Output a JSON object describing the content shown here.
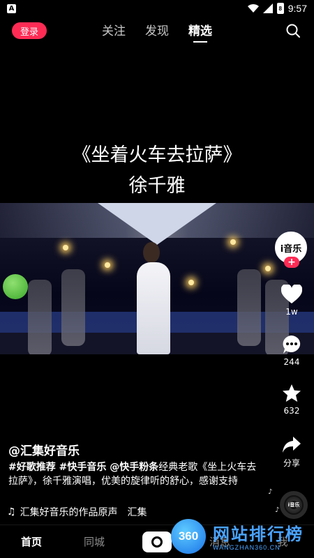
{
  "status_bar": {
    "time": "9:57",
    "notification_icon": "A"
  },
  "top_nav": {
    "login_label": "登录",
    "tabs": [
      {
        "label": "关注",
        "active": false
      },
      {
        "label": "发现",
        "active": false
      },
      {
        "label": "精选",
        "active": true
      }
    ]
  },
  "video": {
    "title": "《坐着火车去拉萨》",
    "subtitle": "徐千雅"
  },
  "side_actions": {
    "avatar_text": "i音乐",
    "follow_label": "+",
    "like_count": "1w",
    "comment_count": "244",
    "favorite_count": "632",
    "share_label": "分享"
  },
  "post": {
    "author": "@汇集好音乐",
    "tags": "#好歌推荐 #快手音乐 @快手粉条",
    "text": "经典老歌《坐上火车去拉萨》，徐千雅演唱，优美的旋律听的舒心，感谢支持",
    "music": "汇集好音乐的作品原声　汇集",
    "disc_text": "i音乐"
  },
  "bottom_nav": {
    "items": [
      "首页",
      "同城",
      "消息",
      "我"
    ]
  },
  "watermark": {
    "logo_text": "360",
    "site_name": "网站排行榜",
    "site_url": "WANGZHAN360.CN"
  },
  "colors": {
    "accent": "#fe2c55",
    "watermark_blue": "#4aa3ff"
  }
}
